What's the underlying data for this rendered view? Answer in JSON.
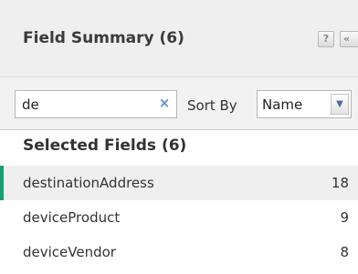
{
  "header": {
    "title": "Field Summary (6)",
    "help_label": "?",
    "collapse_label": "«"
  },
  "controls": {
    "search_value": "de",
    "clear_label": "×",
    "sort_label": "Sort By",
    "sort_value": "Name"
  },
  "section": {
    "title": "Selected Fields (6)"
  },
  "fields": [
    {
      "name": "destinationAddress",
      "count": "18",
      "selected": true
    },
    {
      "name": "deviceProduct",
      "count": "9",
      "selected": false
    },
    {
      "name": "deviceVendor",
      "count": "8",
      "selected": false
    }
  ],
  "colors": {
    "accent": "#1aa070",
    "header_bg": "#efefef",
    "clear_icon": "#5e8fcf"
  }
}
